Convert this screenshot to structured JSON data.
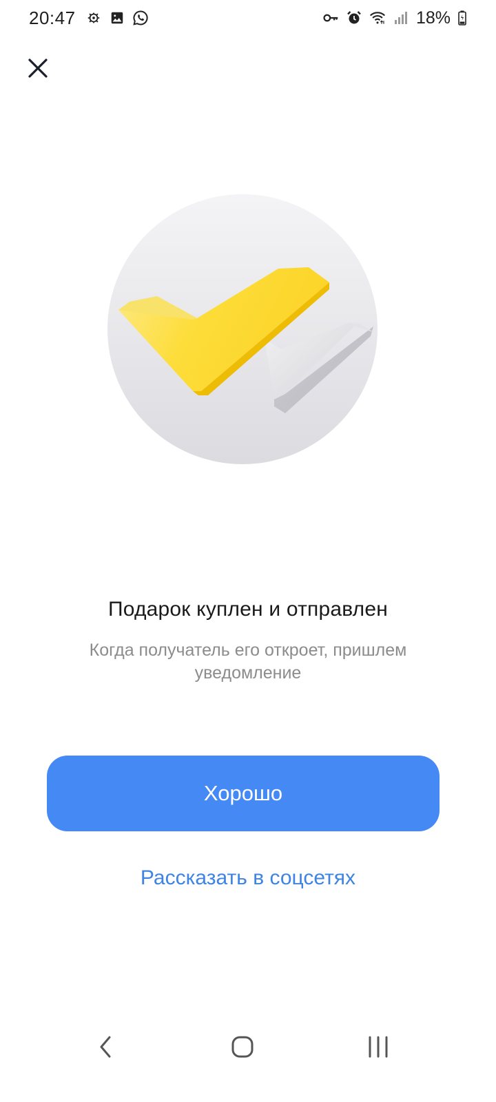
{
  "status_bar": {
    "time": "20:47",
    "battery": "18%",
    "left_icons": [
      "bug-icon",
      "gallery-icon",
      "whatsapp-icon"
    ],
    "right_icons": [
      "key-icon",
      "alarm-icon",
      "wifi-icon",
      "signal-icon",
      "battery-icon"
    ]
  },
  "header": {
    "close_icon": "close-icon"
  },
  "illustration": {
    "name": "double-checkmark-illustration",
    "colors": {
      "circle_top": "#f4f4f6",
      "circle_bottom": "#dcdbe0",
      "check_front": "#fcd52a",
      "check_back": "#d7d6db"
    }
  },
  "message": {
    "title": "Подарок куплен и отправлен",
    "subtitle": "Когда получатель его откроет, пришлем уведомление"
  },
  "actions": {
    "primary_label": "Хорошо",
    "secondary_label": "Рассказать в соцсетях"
  },
  "colors": {
    "primary_button": "#4589f4",
    "link": "#3e84e3",
    "subtitle_text": "#8c8c8c"
  },
  "nav_bar": {
    "icons": [
      "back-icon",
      "home-icon",
      "recents-icon"
    ]
  }
}
